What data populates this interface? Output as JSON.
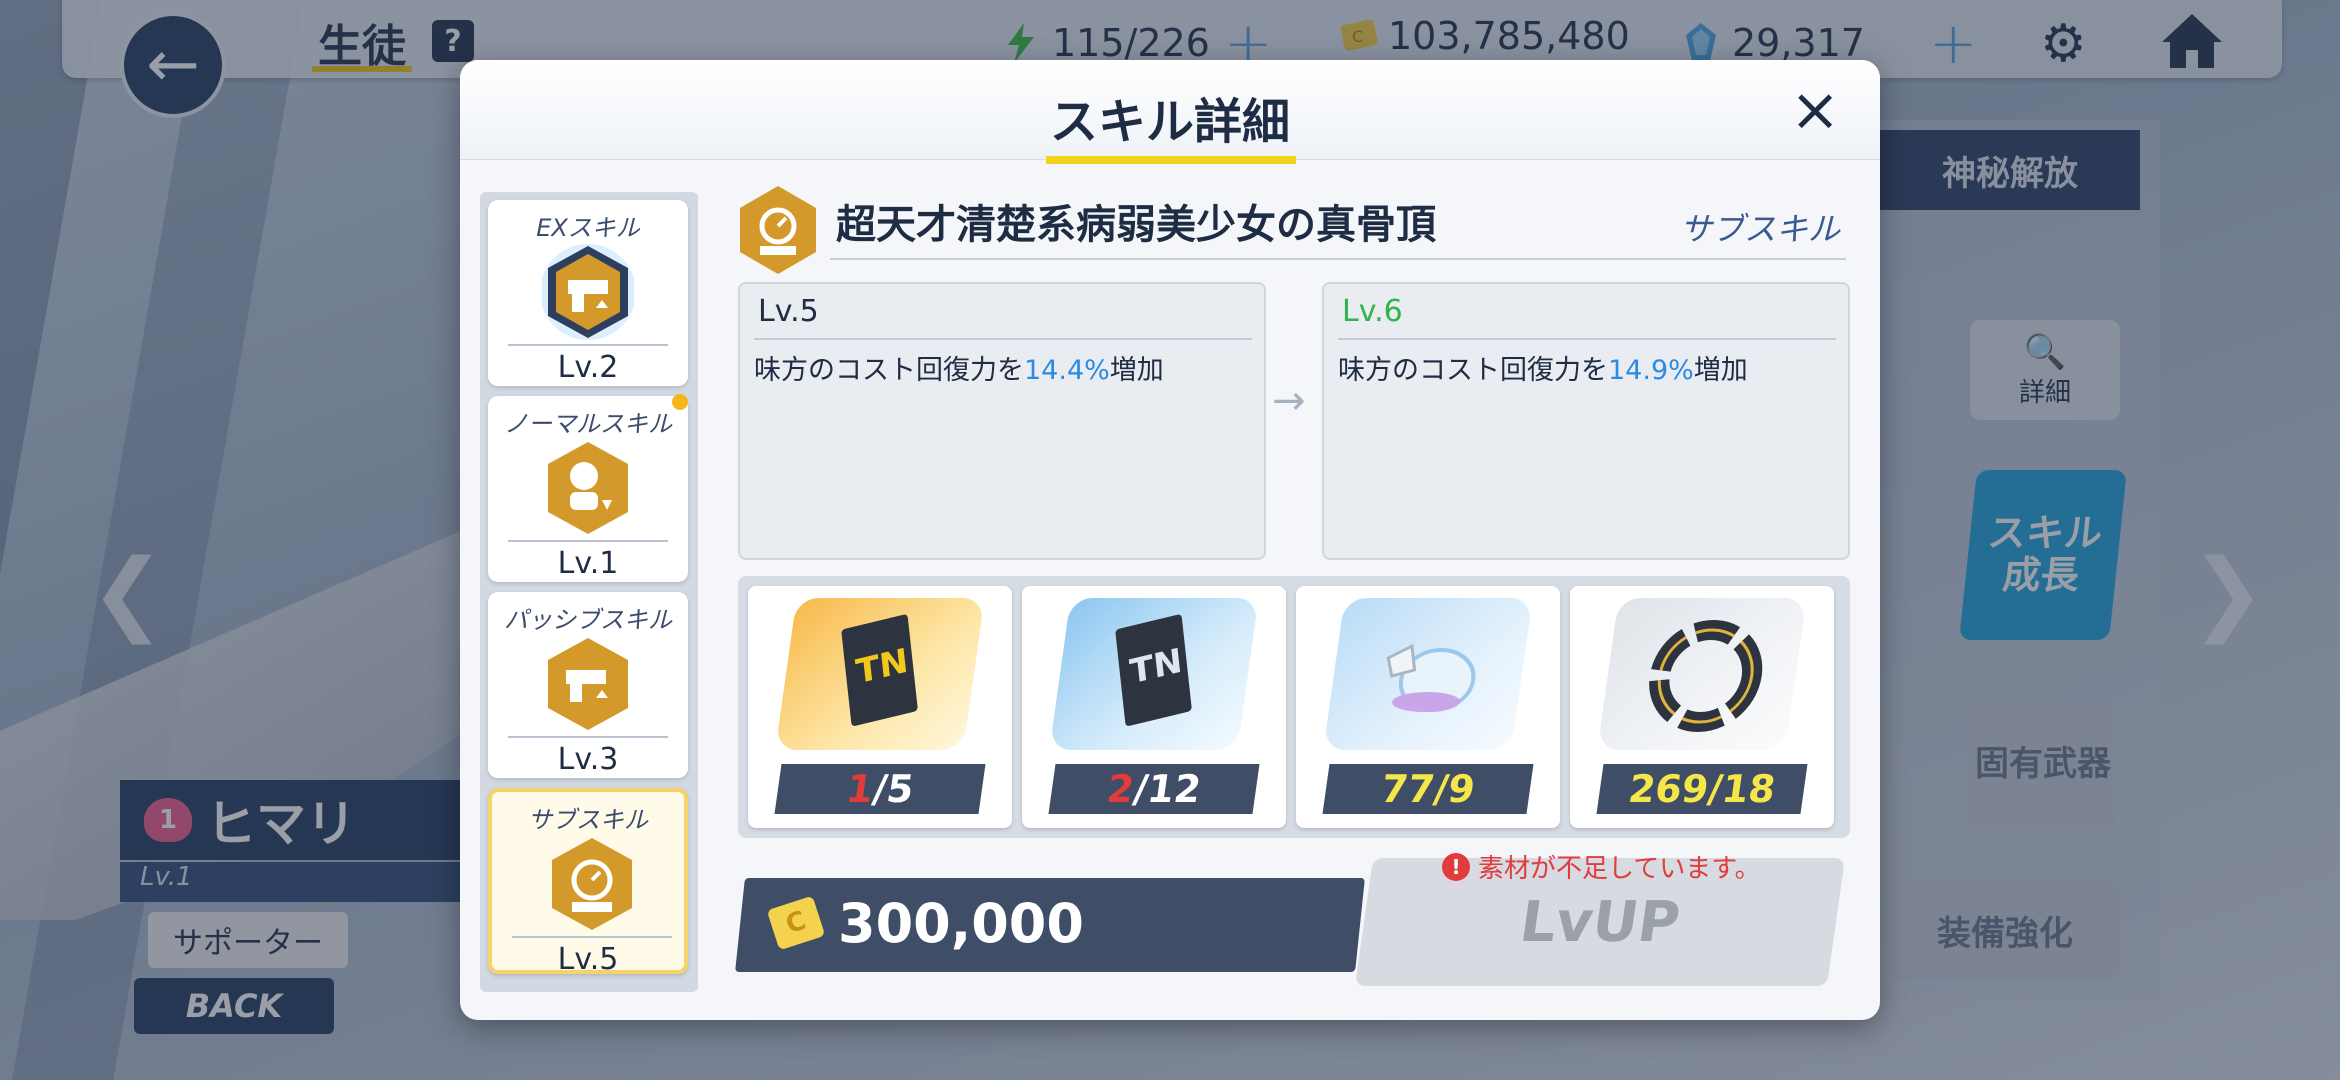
{
  "topbar": {
    "title": "生徒",
    "help": "?",
    "ap": "115/226",
    "credits": "103,785,480",
    "gems": "29,317"
  },
  "background": {
    "right_tab": "神秘解放",
    "detail_label": "詳細",
    "skill_grow": "スキル成長",
    "weapon": "固有武器",
    "equip": "装備強化",
    "char_name": "ヒマリ",
    "char_bond": "1",
    "char_lv": "Lv.1",
    "supporter": "サポーター",
    "back": "BACK"
  },
  "modal": {
    "title": "スキル詳細",
    "close": "×"
  },
  "tabs": [
    {
      "name": "EXスキル",
      "lv": "Lv.2",
      "icon": "pistol-up-icon"
    },
    {
      "name": "ノーマルスキル",
      "lv": "Lv.1",
      "icon": "person-down-icon"
    },
    {
      "name": "パッシブスキル",
      "lv": "Lv.3",
      "icon": "pistol-up-icon"
    },
    {
      "name": "サブスキル",
      "lv": "Lv.5",
      "icon": "cost-clock-icon"
    }
  ],
  "skill": {
    "name": "超天才清楚系病弱美少女の真骨頂",
    "type": "サブスキル",
    "current": {
      "lv": "Lv.5",
      "pre": "味方のコスト回復力を",
      "value": "14.4%",
      "post": "増加"
    },
    "next": {
      "lv": "Lv.6",
      "pre": "味方のコスト回復力を",
      "value": "14.9%",
      "post": "増加"
    }
  },
  "materials": [
    {
      "have": "1",
      "need": "5",
      "icon": "tech-note-gold-icon"
    },
    {
      "have": "2",
      "need": "12",
      "icon": "tech-note-silver-icon"
    },
    {
      "have": "77",
      "need": "9",
      "icon": "ooparts-fragment-icon"
    },
    {
      "have": "269",
      "need": "18",
      "icon": "ooparts-ring-icon"
    }
  ],
  "cost": "300,000",
  "lvup_label": "LvUP",
  "warning": "素材が不足しています。",
  "colors": {
    "accent_yellow": "#f2d21b",
    "navy": "#3f4e66",
    "highlight_blue": "#2a8ae6",
    "next_lv_green": "#2fb34a",
    "short_red": "#e23b3b"
  }
}
